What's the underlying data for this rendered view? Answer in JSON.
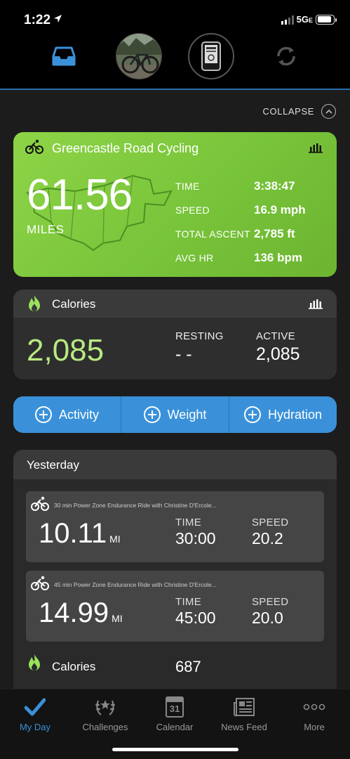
{
  "status_bar": {
    "time": "1:22",
    "network": "5G",
    "network_suffix": "E"
  },
  "top_nav": {
    "items": [
      "inbox-icon",
      "profile-photo",
      "device-icon",
      "sync-icon"
    ],
    "accent": "#3a91d9"
  },
  "collapse_label": "COLLAPSE",
  "activity": {
    "title": "Greencastle Road Cycling",
    "distance": "61.56",
    "distance_unit": "MILES",
    "stats": [
      {
        "label": "TIME",
        "value": "3:38:47"
      },
      {
        "label": "SPEED",
        "value": "16.9 mph"
      },
      {
        "label": "TOTAL ASCENT",
        "value": "2,785 ft"
      },
      {
        "label": "AVG HR",
        "value": "136 bpm"
      }
    ],
    "color": "#7cc63e"
  },
  "calories": {
    "title": "Calories",
    "total": "2,085",
    "resting_label": "RESTING",
    "resting_value": "- -",
    "active_label": "ACTIVE",
    "active_value": "2,085",
    "total_color": "#b8ea82"
  },
  "quick_add": {
    "buttons": [
      "Activity",
      "Weight",
      "Hydration"
    ],
    "color": "#3a91d9"
  },
  "yesterday": {
    "title": "Yesterday",
    "rides": [
      {
        "name": "30 min Power Zone Endurance Ride with Christine D'Ercole...",
        "distance": "10.11",
        "unit": "MI",
        "time_label": "TIME",
        "time": "30:00",
        "speed_label": "SPEED",
        "speed": "20.2"
      },
      {
        "name": "45 min Power Zone Endurance Ride with Christine D'Ercole...",
        "distance": "14.99",
        "unit": "MI",
        "time_label": "TIME",
        "time": "45:00",
        "speed_label": "SPEED",
        "speed": "20.0"
      }
    ],
    "calories_label": "Calories",
    "calories_value": "687"
  },
  "tab_bar": {
    "tabs": [
      {
        "label": "My Day",
        "icon": "checkmark-icon",
        "active": true
      },
      {
        "label": "Challenges",
        "icon": "laurel-icon",
        "active": false
      },
      {
        "label": "Calendar",
        "icon": "calendar-icon",
        "active": false
      },
      {
        "label": "News Feed",
        "icon": "newspaper-icon",
        "active": false
      },
      {
        "label": "More",
        "icon": "more-dots-icon",
        "active": false
      }
    ],
    "calendar_day": "31"
  }
}
